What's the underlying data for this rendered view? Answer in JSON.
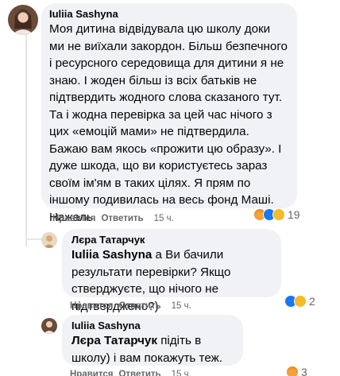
{
  "comments": [
    {
      "author": "Iuliia Sashyna",
      "text": "Моя дитина відвідувала цю школу доки ми не виїхали закордон. Більш безпечного і ресурсного середовища для дитини я не знаю. І жоден більш із всіх батьків не підтвердить жодного слова сказаного тут. Та і жодна перевірка за цей час нічого з цих «емоцій мами» не підтвердила. Бажаю вам якось «прожити цю образу». І дуже шкода, що ви користуєтесь зараз своїм ім'ям в таких цілях. Я прям по іншому подивилась на весь фонд Маші. Нажаль.",
      "like_label": "Нравится",
      "reply_label": "Ответить",
      "time": "15 ч.",
      "reaction_count": "19",
      "reactions": [
        "angry",
        "like",
        "wow"
      ]
    },
    {
      "author": "Лєра Татарчук",
      "mention": "Iuliia Sashyna",
      "text": " а Ви бачили результати перевірки? Якщо стверджуєте, що нічого не підтверджено?)",
      "like_label": "Нравится",
      "reply_label": "Ответить",
      "time": "15 ч.",
      "reaction_count": "2",
      "reactions": [
        "like",
        "care"
      ]
    },
    {
      "author": "Iuliia Sashyna",
      "mention": "Лєра Татарчук",
      "text": " підіть в школу) і вам покажуть теж.",
      "like_label": "Нравится",
      "reply_label": "Ответить",
      "time": "15 ч.",
      "reaction_count": "3",
      "reactions": [
        "angry"
      ]
    }
  ]
}
